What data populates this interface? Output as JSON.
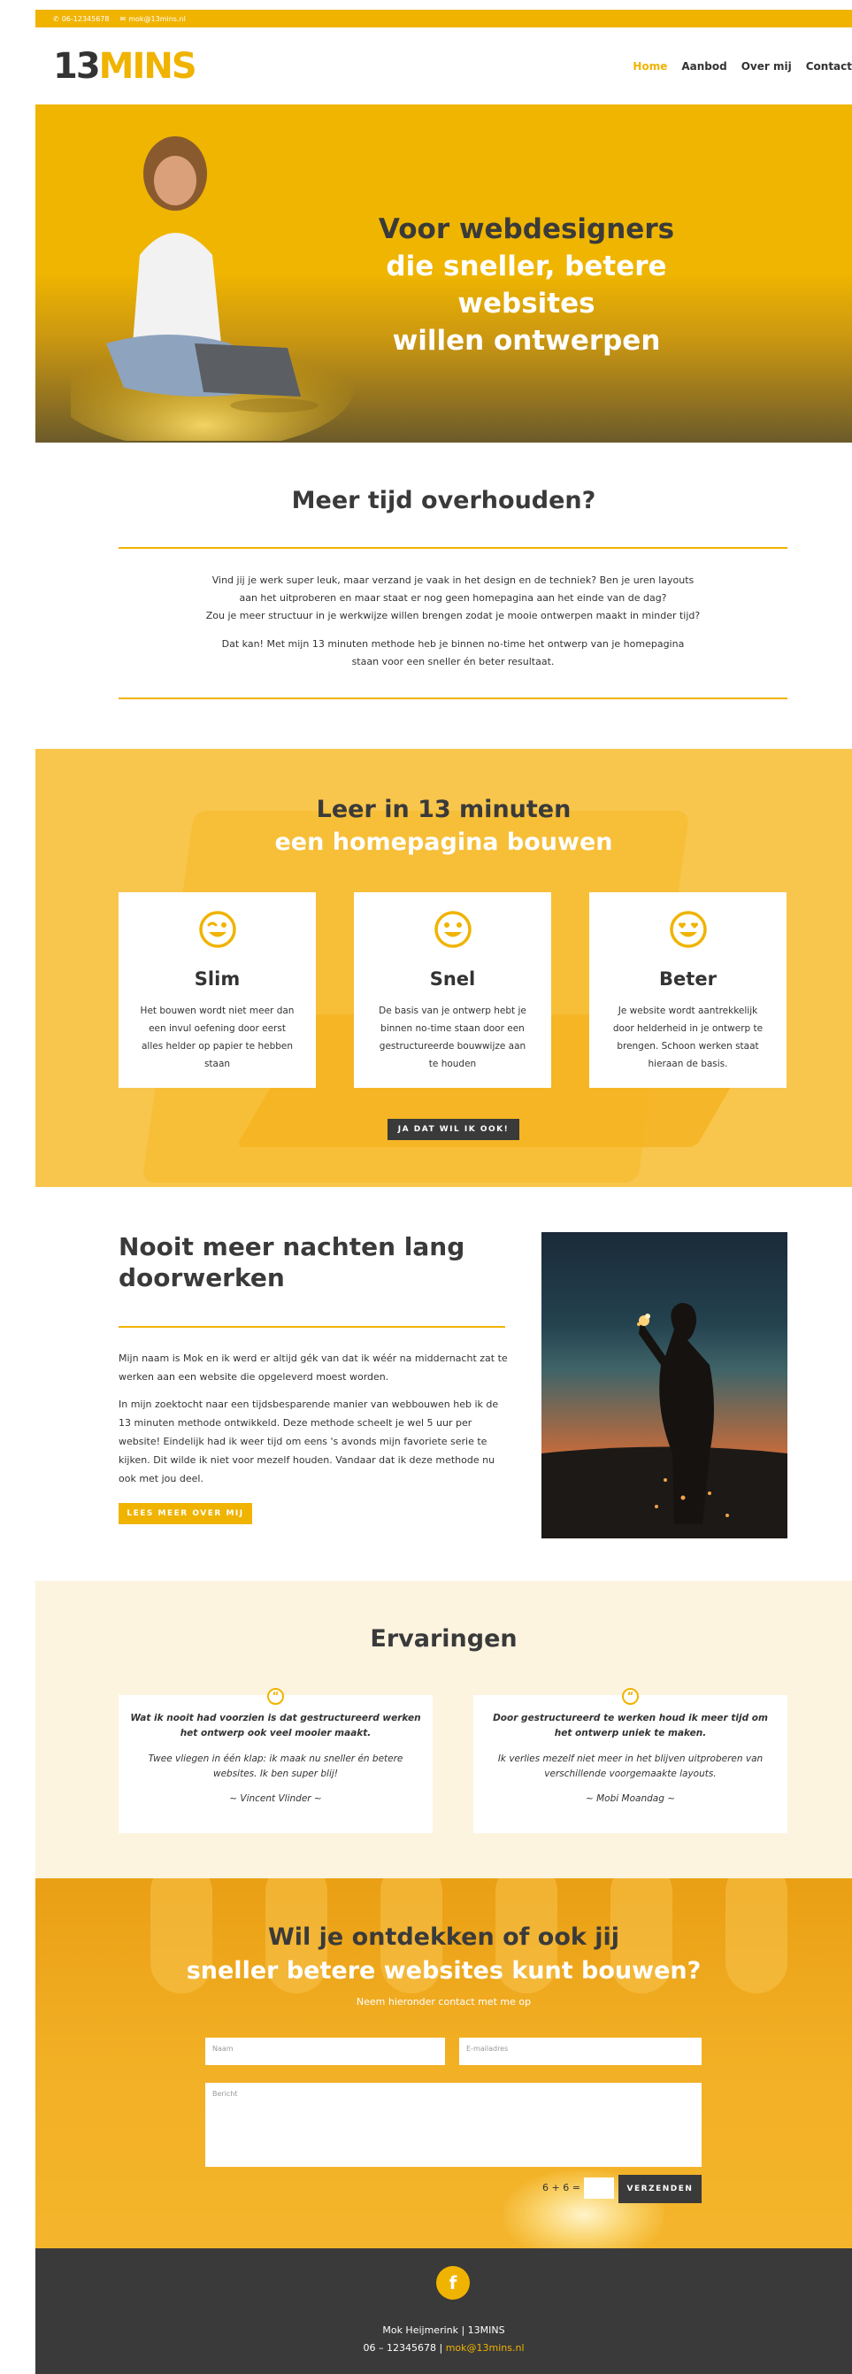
{
  "topbar": {
    "phone": "06-12345678",
    "email": "mok@13mins.nl"
  },
  "header": {
    "logo_part1": "13",
    "logo_part2": "MINS",
    "nav": [
      "Home",
      "Aanbod",
      "Over mij",
      "Contact"
    ]
  },
  "hero": {
    "line1": "Voor webdesigners",
    "line2": "die sneller, betere websites",
    "line3": "willen ontwerpen"
  },
  "intro": {
    "title": "Meer tijd overhouden?",
    "p1_l1": "Vind jij je werk super leuk, maar verzand je vaak in het design en de techniek? Ben je uren layouts",
    "p1_l2": "aan het uitproberen en maar staat er nog geen homepagina aan het einde van de dag?",
    "p1_l3": "Zou je meer structuur in je werkwijze willen brengen zodat je mooie ontwerpen maakt in minder tijd?",
    "p2_l1": "Dat kan! Met mijn 13 minuten methode heb je binnen no-time het ontwerp van je homepagina",
    "p2_l2": "staan voor een sneller én beter resultaat."
  },
  "learn": {
    "title_line1": "Leer in 13 minuten",
    "title_line2": "een homepagina bouwen",
    "cards": [
      {
        "icon": "wink-face-icon",
        "title": "Slim",
        "text": "Het bouwen wordt niet meer dan een invul oefening door eerst alles helder op papier te hebben staan"
      },
      {
        "icon": "smile-face-icon",
        "title": "Snel",
        "text": "De basis van je ontwerp hebt je binnen no-time staan door een gestructureerde bouwwijze aan te houden"
      },
      {
        "icon": "heart-eyes-face-icon",
        "title": "Beter",
        "text": "Je website wordt aantrekkelijk door helderheid in je ontwerp te brengen. Schoon werken staat hieraan de basis."
      }
    ],
    "button": "JA DAT WIL IK OOK!"
  },
  "about": {
    "title_line1": "Nooit meer nachten lang",
    "title_line2": "doorwerken",
    "p1": "Mijn naam is Mok en ik werd er altijd gék van dat ik wéér na middernacht zat te werken aan een website die opgeleverd moest worden.",
    "p2": "In mijn zoektocht naar een tijdsbesparende manier van webbouwen heb ik de 13 minuten methode ontwikkeld. Deze methode scheelt je wel 5 uur per website! Eindelijk had ik weer tijd om eens 's avonds mijn favoriete serie te kijken. Dit wilde ik niet voor mezelf houden. Vandaar dat ik deze methode nu ook met jou deel.",
    "button": "LEES MEER OVER MIJ"
  },
  "reviews": {
    "title": "Ervaringen",
    "items": [
      {
        "bold": "Wat ik nooit had voorzien is dat gestructureerd werken het ontwerp ook veel mooier maakt.",
        "text": "Twee vliegen in één klap: ik maak nu sneller én betere websites. Ik ben super blij!",
        "author": "~ Vincent Vlinder ~"
      },
      {
        "bold": "Door gestructureerd te werken houd ik meer tijd om het ontwerp uniek te maken.",
        "text": "Ik verlies mezelf niet meer in het blijven uitproberen van verschillende voorgemaakte layouts.",
        "author": "~ Mobi Moandag ~"
      }
    ]
  },
  "contact": {
    "title_line1": "Wil je ontdekken of ook jij",
    "title_line2": "sneller betere websites kunt bouwen?",
    "subtitle": "Neem hieronder contact met me op",
    "name_placeholder": "Naam",
    "email_placeholder": "E-mailadres",
    "message_placeholder": "Bericht",
    "captcha": "6 + 6 =",
    "submit": "VERZENDEN"
  },
  "footer": {
    "line1": "Mok Heijmerink | 13MINS",
    "phone": "06 – 12345678 | ",
    "email": "mok@13mins.nl"
  }
}
